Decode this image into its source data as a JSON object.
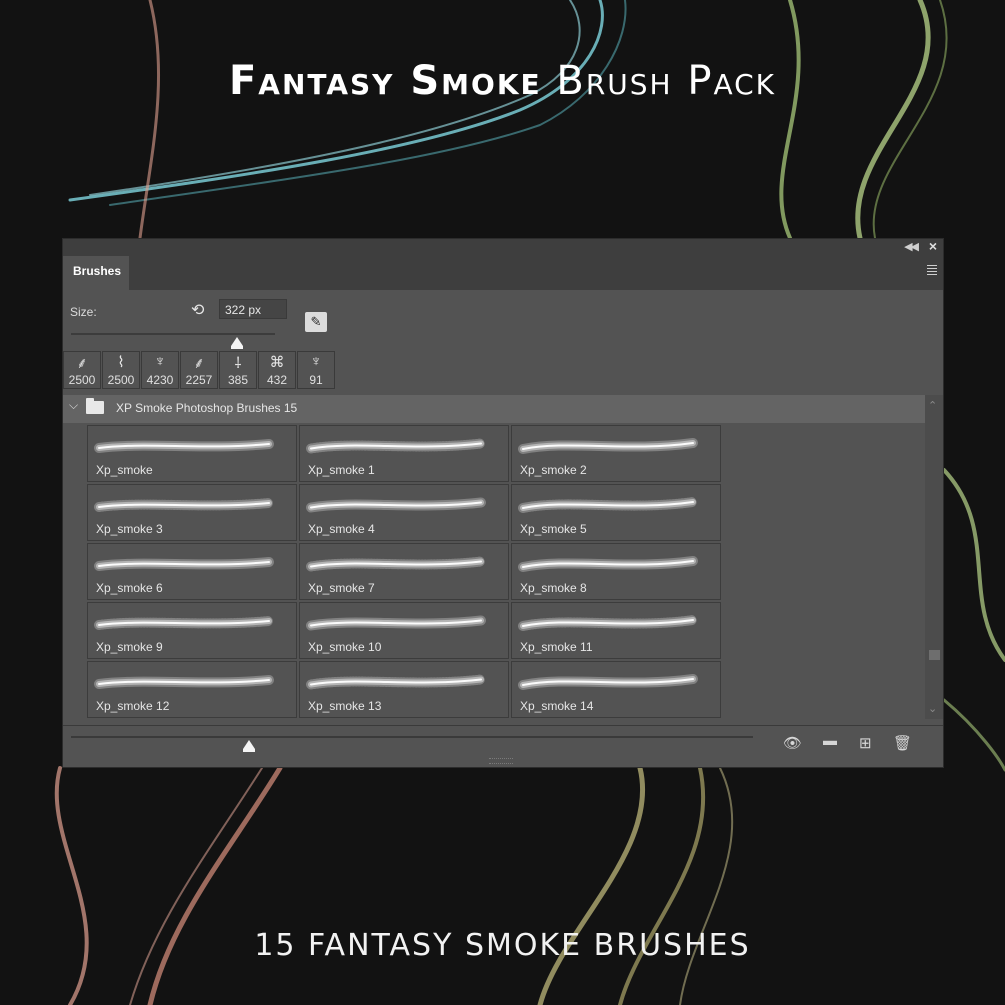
{
  "poster": {
    "title_bold": "Fantasy Smoke",
    "title_light": "Brush Pack",
    "subtitle": "15 FANTASY SMOKE BRUSHES"
  },
  "panel": {
    "tab_label": "Brushes",
    "size_label": "Size:",
    "size_value": "322 px",
    "presets": [
      {
        "icon": "smoke-tip-icon",
        "size": "2500"
      },
      {
        "icon": "smoke-tip-icon",
        "size": "2500"
      },
      {
        "icon": "smoke-tip-icon",
        "size": "4230"
      },
      {
        "icon": "smoke-tip-icon",
        "size": "2257"
      },
      {
        "icon": "smoke-tip-icon",
        "size": "385"
      },
      {
        "icon": "smoke-tip-icon",
        "size": "432"
      },
      {
        "icon": "smoke-tip-icon",
        "size": "91"
      }
    ],
    "folder_name": "XP Smoke Photoshop Brushes 15",
    "brushes": [
      "Xp_smoke",
      "Xp_smoke 1",
      "Xp_smoke 2",
      "Xp_smoke 3",
      "Xp_smoke 4",
      "Xp_smoke 5",
      "Xp_smoke 6",
      "Xp_smoke 7",
      "Xp_smoke 8",
      "Xp_smoke 9",
      "Xp_smoke 10",
      "Xp_smoke 11",
      "Xp_smoke 12",
      "Xp_smoke 13",
      "Xp_smoke 14"
    ],
    "bottom_icons": [
      "visibility-icon",
      "folder-icon",
      "new-brush-icon",
      "trash-icon"
    ]
  },
  "colors": {
    "background": "#121212",
    "panel": "#535353",
    "smoke_cyan": "#7fd6e0",
    "smoke_green": "#b8d48a",
    "smoke_pink": "#e0a090",
    "smoke_olive": "#c8c080"
  }
}
